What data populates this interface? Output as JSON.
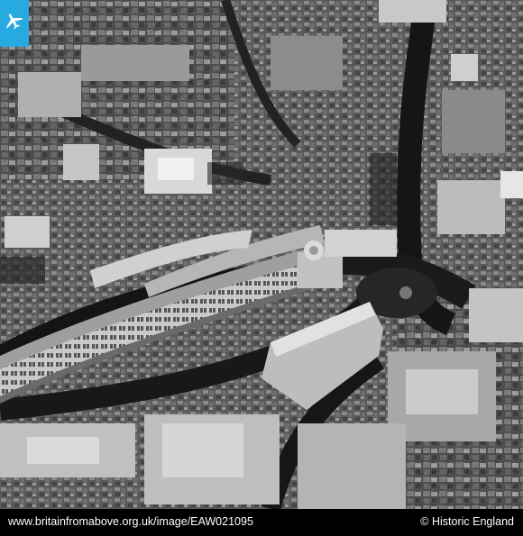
{
  "footer": {
    "url": "www.britainfromabove.org.uk/image/EAW021095",
    "copyright": "© Historic England"
  },
  "badge": {
    "icon": "airplane-icon",
    "color": "#27a9e1"
  }
}
